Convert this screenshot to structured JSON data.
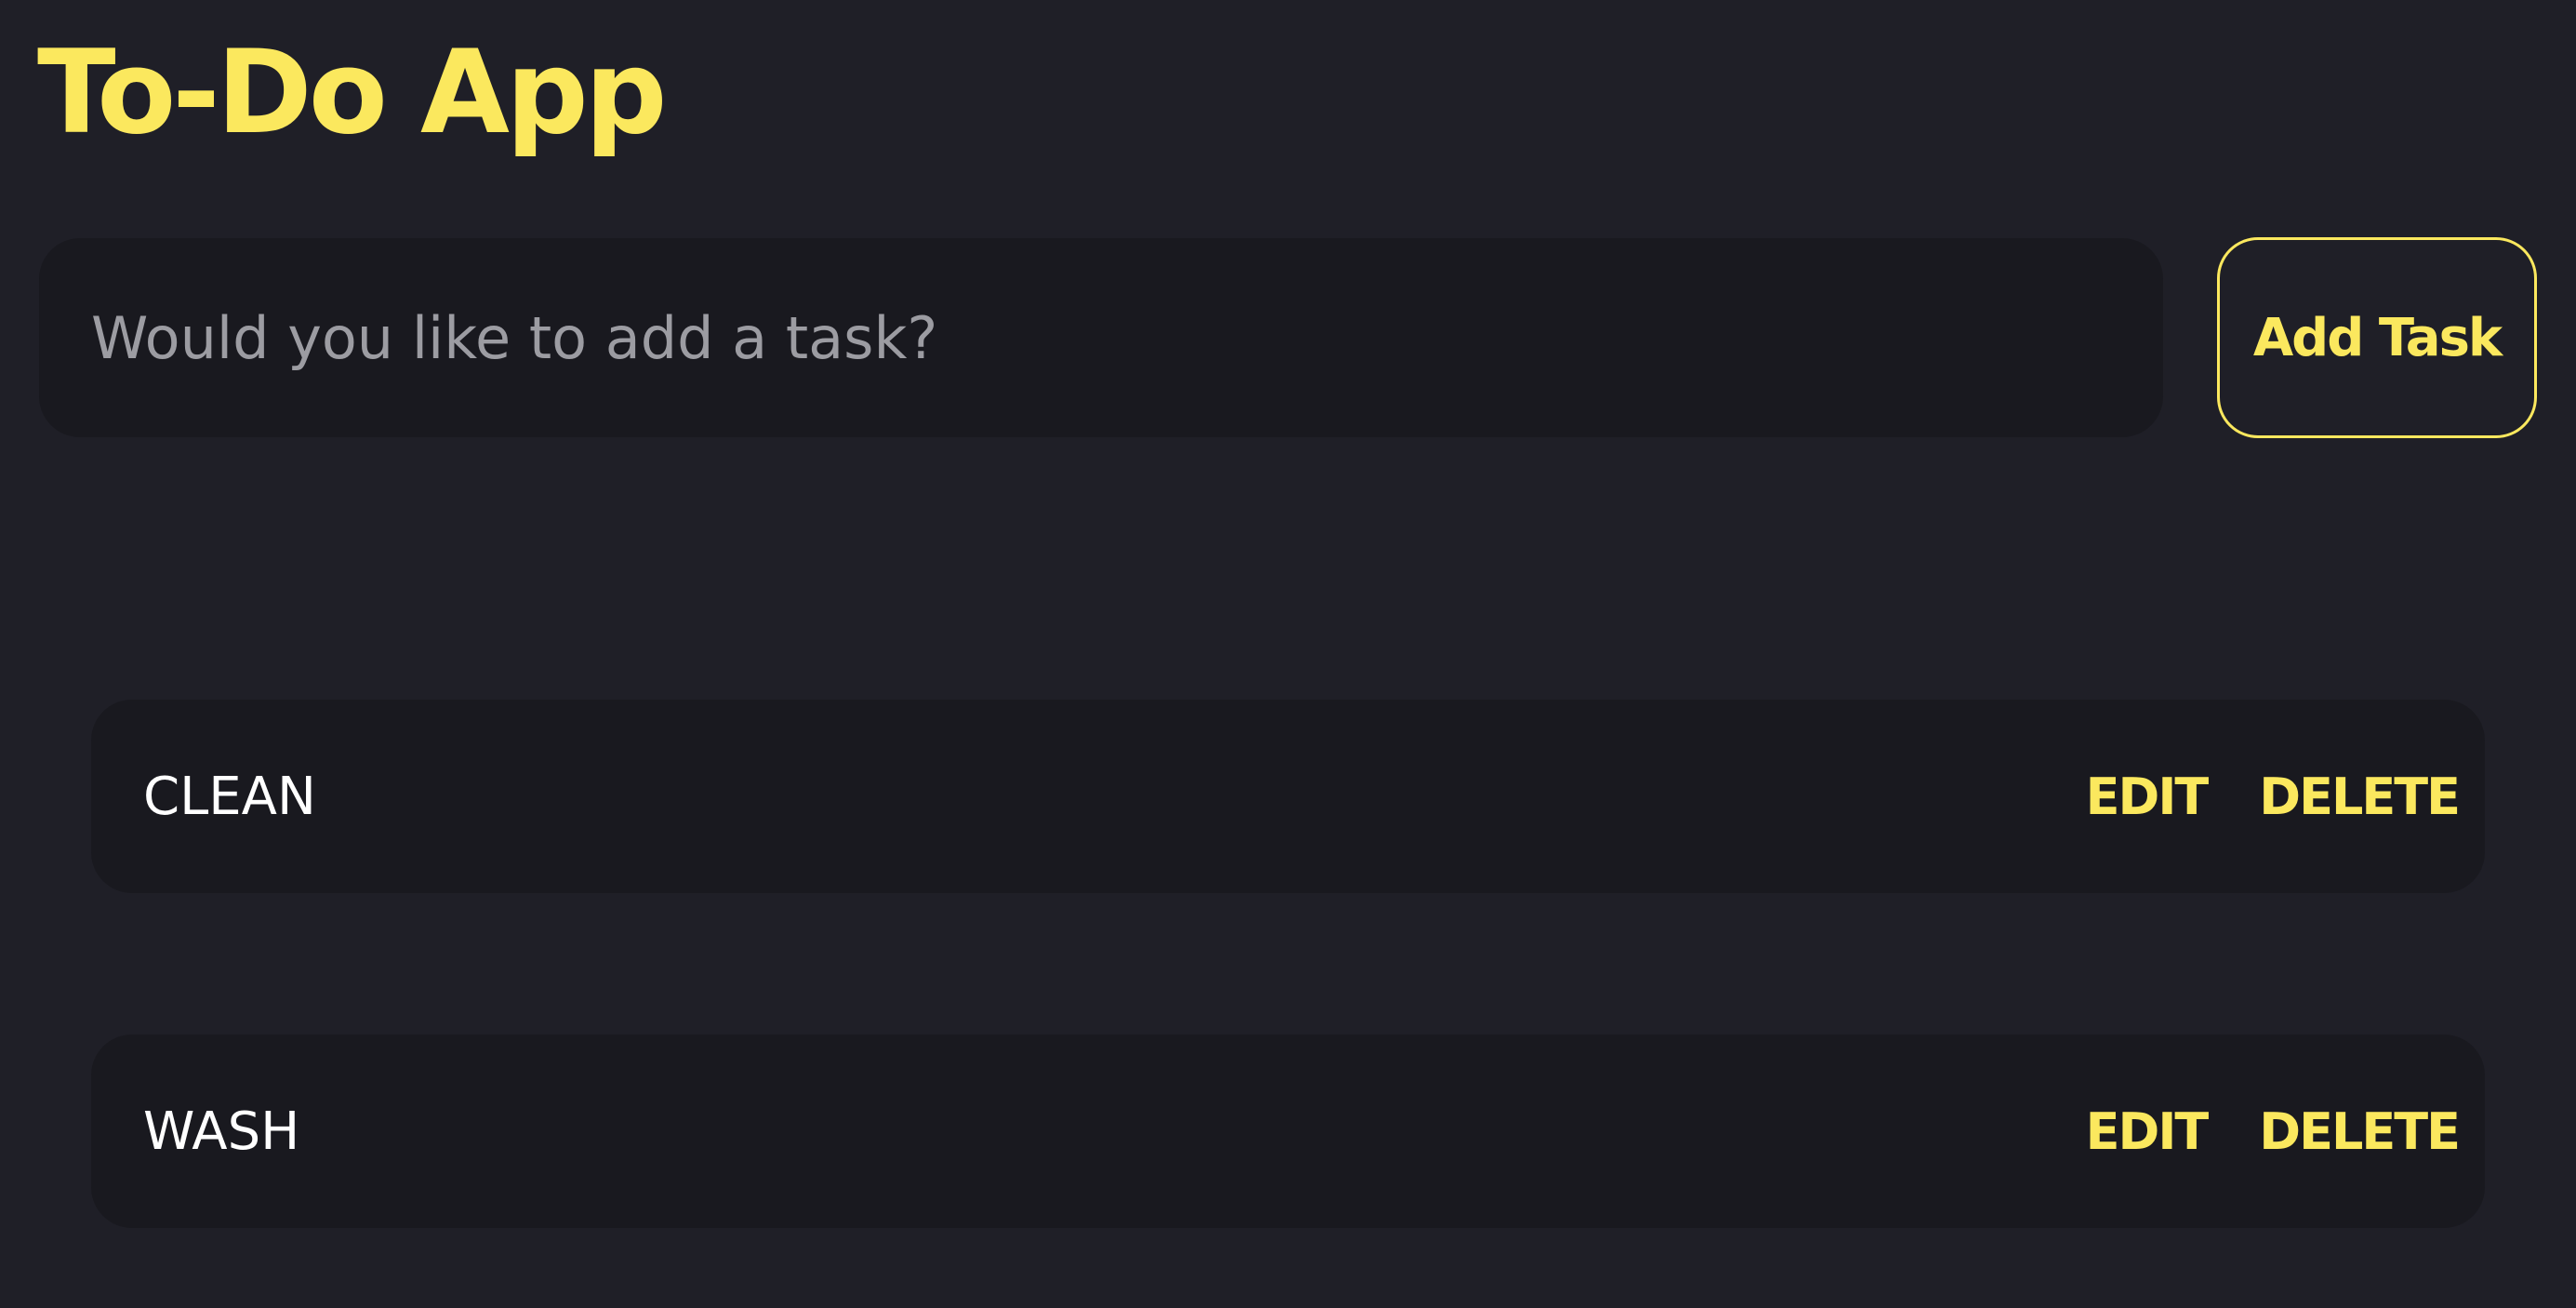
{
  "header": {
    "title": "To-Do App"
  },
  "new_task": {
    "placeholder": "Would you like to add a task?",
    "value": "",
    "add_button_label": "Add Task"
  },
  "tasks": [
    {
      "text": "CLEAN",
      "edit_label": "EDIT",
      "delete_label": "DELETE"
    },
    {
      "text": "WASH",
      "edit_label": "EDIT",
      "delete_label": "DELETE"
    }
  ],
  "colors": {
    "background": "#1f1f27",
    "surface": "#19191f",
    "accent": "#fbe85e",
    "placeholder": "#9c9ca2",
    "text": "#ffffff"
  }
}
